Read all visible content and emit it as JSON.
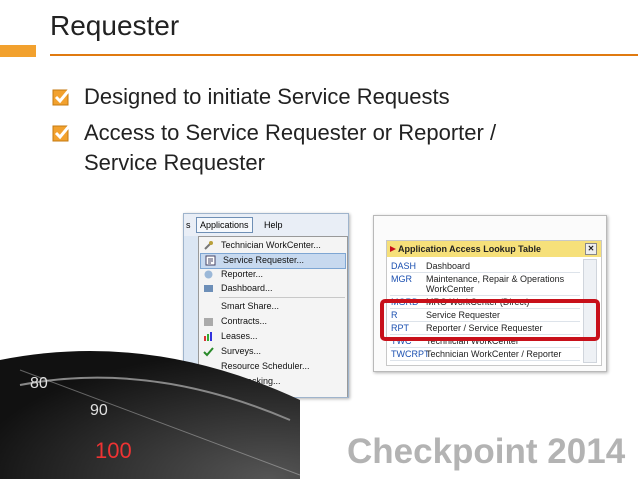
{
  "slide": {
    "title": "Requester",
    "bullets": [
      "Designed to initiate Service Requests",
      "Access to Service Requester or Reporter / Service Requester"
    ],
    "footer_logo": "Checkpoint 2014"
  },
  "menu_screenshot": {
    "menubar": {
      "left_fragment": "s",
      "applications": "Applications",
      "help": "Help"
    },
    "items": [
      {
        "label": "Technician WorkCenter..."
      },
      {
        "label": "Service Requester...",
        "selected": true
      },
      {
        "label": "Reporter..."
      },
      {
        "label": "Dashboard..."
      },
      {
        "label": "Smart Share..."
      },
      {
        "label": "Contracts..."
      },
      {
        "label": "Leases..."
      },
      {
        "label": "Surveys..."
      },
      {
        "label": "Resource Scheduler..."
      },
      {
        "label": "Key Tracking..."
      }
    ]
  },
  "lookup_screenshot": {
    "title": "Application Access Lookup Table",
    "close": "✕",
    "rows": [
      {
        "code": "DASH",
        "desc": "Dashboard"
      },
      {
        "code": "MGR",
        "desc": "Maintenance, Repair & Operations WorkCenter"
      },
      {
        "code": "MGRD",
        "desc": "MRO WorkCenter (Direct)"
      },
      {
        "code": "R",
        "desc": "Service Requester"
      },
      {
        "code": "RPT",
        "desc": "Reporter / Service Requester"
      },
      {
        "code": "TWC",
        "desc": "Technician WorkCenter"
      },
      {
        "code": "TWCRPT",
        "desc": "Technician WorkCenter / Reporter"
      }
    ]
  },
  "colors": {
    "accent": "#e07a10",
    "highlight": "#c8101a",
    "lookup_header": "#f6e07a"
  }
}
